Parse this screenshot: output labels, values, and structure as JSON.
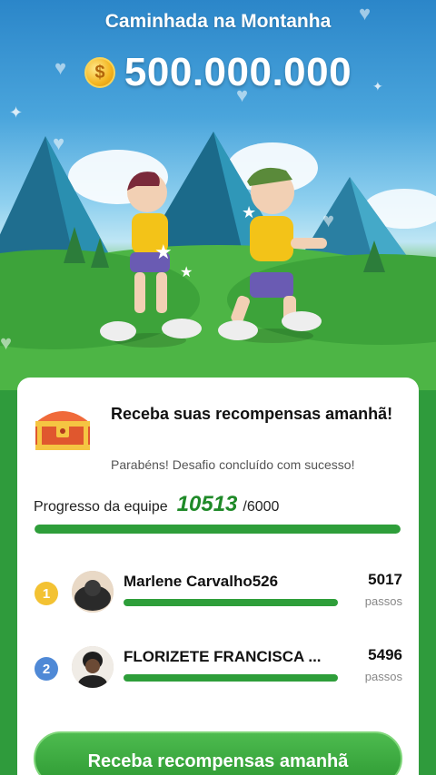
{
  "header": {
    "title": "Caminhada na Montanha",
    "prize_amount": "500.000.000",
    "coin_icon": "coin-icon"
  },
  "card": {
    "reward_title": "Receba suas recompensas amanhã!",
    "reward_subtitle": "Parabéns! Desafio concluído com sucesso!",
    "progress_label": "Progresso da equipe",
    "progress_value": "10513",
    "progress_goal": "/6000",
    "progress_fraction": 1.0
  },
  "members": [
    {
      "rank": "1",
      "name": "Marlene Carvalho526",
      "steps": "5017",
      "unit": "passos",
      "fraction": 1.0
    },
    {
      "rank": "2",
      "name": "FLORIZETE FRANCISCA ...",
      "steps": "5496",
      "unit": "passos",
      "fraction": 1.0
    }
  ],
  "cta": {
    "label": "Receba recompensas amanhã"
  },
  "colors": {
    "accent_green": "#2e9e3a",
    "progress_text": "#1f8a28",
    "gold_rank": "#f3c233",
    "blue_rank": "#4f89d6"
  }
}
